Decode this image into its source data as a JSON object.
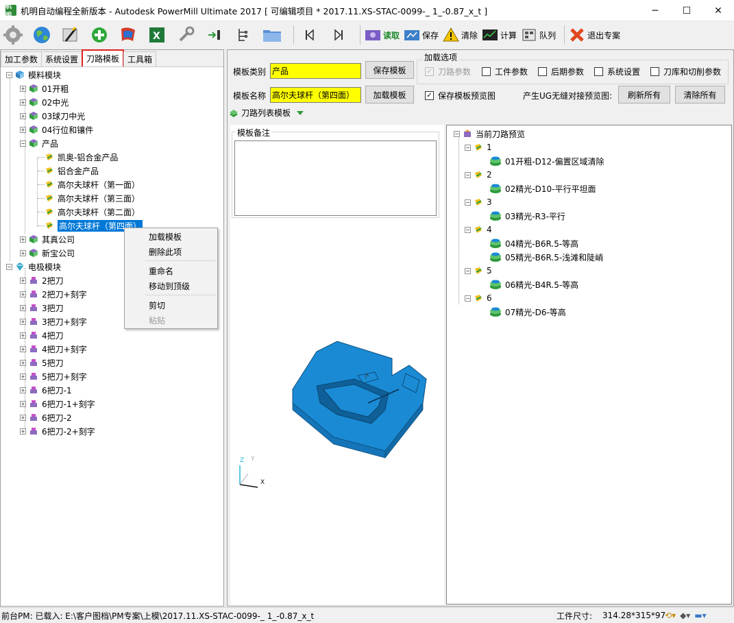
{
  "window": {
    "app_icon_text": "机明",
    "title": "机明自动编程全新版本 - Autodesk PowerMill Ultimate 2017    [ 可编辑项目 * 2017.11.XS-STAC-0099-_ 1_-0.87_x_t ]",
    "controls": {
      "minimize": "─",
      "maximize": "☐",
      "close": "✕"
    }
  },
  "toolbar": {
    "icons": [
      "gear-icon",
      "globe-icon",
      "wand-icon",
      "add-icon",
      "flag-icon",
      "excel-icon",
      "wrench-icon",
      "import-icon",
      "tree-icon",
      "folder-icon",
      "first-icon",
      "last-icon"
    ],
    "buttons": [
      {
        "name": "read",
        "label": "读取",
        "icon": "read-icon"
      },
      {
        "name": "save",
        "label": "保存",
        "icon": "save-icon"
      },
      {
        "name": "clear",
        "label": "清除",
        "icon": "warning-icon"
      },
      {
        "name": "calc",
        "label": "计算",
        "icon": "chart-icon"
      },
      {
        "name": "queue",
        "label": "队列",
        "icon": "queue-icon"
      },
      {
        "name": "exit",
        "label": "退出专案",
        "icon": "exit-icon"
      }
    ]
  },
  "left_tabs": [
    "加工参数",
    "系统设置",
    "刀路模板",
    "工具箱"
  ],
  "left_tree": {
    "group1": {
      "label": "模料模块",
      "items": [
        "01开粗",
        "02中光",
        "03球刀中光",
        "04行位和镶件"
      ],
      "product": {
        "label": "产品",
        "children": [
          "凯奥-铝合金产品",
          "铝合金产品",
          "高尔夫球杆（第一面）",
          "高尔夫球杆（第三面）",
          "高尔夫球杆（第二面）",
          "高尔夫球杆（第四面）"
        ]
      },
      "after": [
        "其真公司",
        "新宝公司"
      ]
    },
    "group2": {
      "label": "电极模块",
      "items": [
        "2把刀",
        "2把刀+刻字",
        "3把刀",
        "3把刀+刻字",
        "4把刀",
        "4把刀+刻字",
        "5把刀",
        "5把刀+刻字",
        "6把刀-1",
        "6把刀-1+刻字",
        "6把刀-2",
        "6把刀-2+刻字"
      ]
    }
  },
  "context_menu": {
    "load": "加载模板",
    "delete": "删除此项",
    "rename": "重命名",
    "move_top": "移动到顶级",
    "cut": "剪切",
    "paste": "粘贴"
  },
  "form": {
    "category_label": "模板类别",
    "category_value": "产品",
    "name_label": "模板名称",
    "name_value": "高尔夫球杆（第四面）",
    "save_template_button": "保存模板",
    "load_template_button": "加载模板",
    "save_preview_label": "保存模板预览图",
    "save_preview_checked": true,
    "load_options_title": "加载选项",
    "options": [
      {
        "label": "刀路参数",
        "checked": true,
        "disabled": true
      },
      {
        "label": "工件参数",
        "checked": false,
        "disabled": false
      },
      {
        "label": "后期参数",
        "checked": false,
        "disabled": false
      },
      {
        "label": "系统设置",
        "checked": false,
        "disabled": false
      },
      {
        "label": "刀库和切削参数",
        "checked": false,
        "disabled": false
      }
    ],
    "ug_label": "产生UG无缝对接预览图:",
    "refresh_all": "刷新所有",
    "clear_all": "清除所有"
  },
  "toolpath_list_template": "刀路列表模板",
  "notes_title": "模板备注",
  "notes_value": "",
  "preview": {
    "root": "当前刀路预览",
    "groups": [
      {
        "id": "1",
        "paths": [
          "01开粗-D12-偏置区域清除"
        ]
      },
      {
        "id": "2",
        "paths": [
          "02精光-D10-平行平坦面"
        ]
      },
      {
        "id": "3",
        "paths": [
          "03精光-R3-平行"
        ]
      },
      {
        "id": "4",
        "paths": [
          "04精光-B6R.5-等高",
          "05精光-B6R.5-浅滩和陡峭"
        ]
      },
      {
        "id": "5",
        "paths": [
          "06精光-B4R.5-等高"
        ]
      },
      {
        "id": "6",
        "paths": [
          "07精光-D6-等高"
        ]
      }
    ]
  },
  "axis_labels": {
    "x": "X",
    "y": "Y",
    "z": "Z"
  },
  "status": {
    "loaded": "前台PM: 已载入: E:\\客户图档\\PM专案\\上模\\2017.11.XS-STAC-0099-_ 1_-0.87_x_t",
    "size_label": "工件尺寸:",
    "size_value": "314.28*315*97"
  },
  "colors": {
    "accent": "#0078d7",
    "highlight": "#ffff00",
    "part": "#1a8ad4",
    "tab_outline": "#e0201c"
  }
}
